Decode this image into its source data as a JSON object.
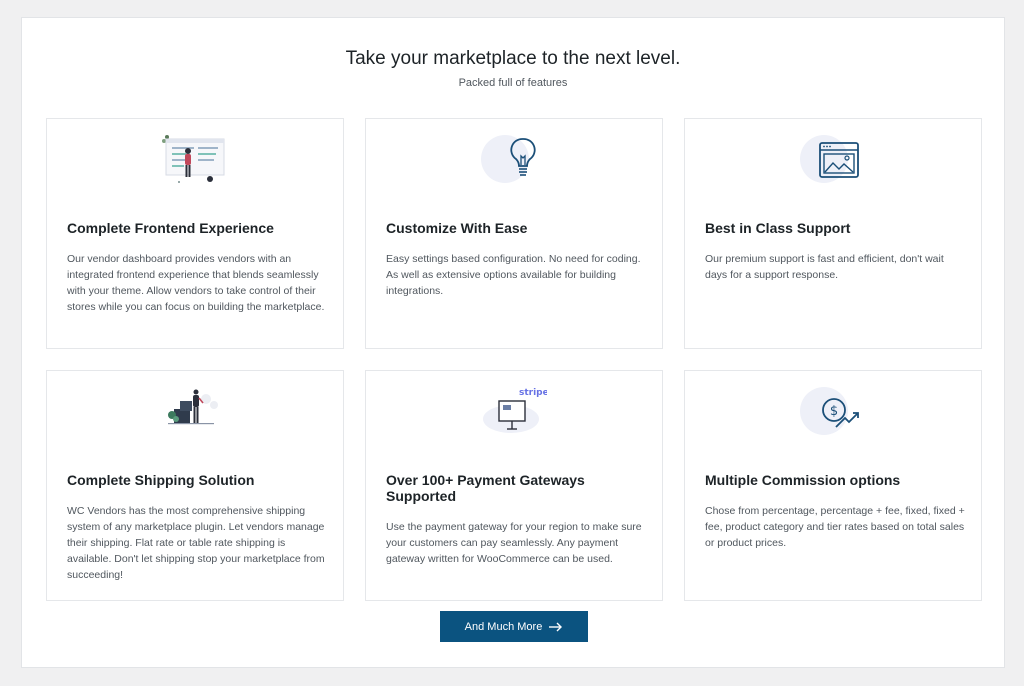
{
  "header": {
    "title": "Take your marketplace to the next level.",
    "subtitle": "Packed full of features"
  },
  "features": [
    {
      "title": "Complete Frontend Experience",
      "description": "Our vendor dashboard provides vendors with an integrated frontend experience that blends seamlessly with your theme. Allow vendors to take control of their stores while you can focus on building the marketplace.",
      "icon": "dashboard-illustration-icon"
    },
    {
      "title": "Customize With Ease",
      "description": "Easy settings based configuration. No need for coding. As well as extensive options available for building integrations.",
      "icon": "lightbulb-icon"
    },
    {
      "title": "Best in Class Support",
      "description": "Our premium support is fast and efficient, don't wait days for a support response.",
      "icon": "browser-image-icon"
    },
    {
      "title": "Complete Shipping Solution",
      "description": "WC Vendors has the most comprehensive shipping system of any marketplace plugin. Let vendors manage their shipping. Flat rate or table rate shipping is available. Don't let shipping stop your marketplace from succeeding!",
      "icon": "shipping-illustration-icon"
    },
    {
      "title": "Over 100+ Payment Gateways Supported",
      "description": "Use the payment gateway for your region to make sure your customers can pay seamlessly. Any payment gateway written for WooCommerce can be used.",
      "icon": "stripe-payment-illustration-icon",
      "badge": "stripe"
    },
    {
      "title": "Multiple Commission options",
      "description": "Chose from percentage, percentage + fee, fixed, fixed + fee, product category and tier rates based on total sales or product prices.",
      "icon": "dollar-growth-icon"
    }
  ],
  "cta": {
    "label": "And Much More",
    "icon": "arrow-right-icon"
  },
  "colors": {
    "accent": "#0b5380",
    "icon_stroke": "#1b4f78",
    "icon_bg": "#eef0f8",
    "person": "#c0485a"
  }
}
